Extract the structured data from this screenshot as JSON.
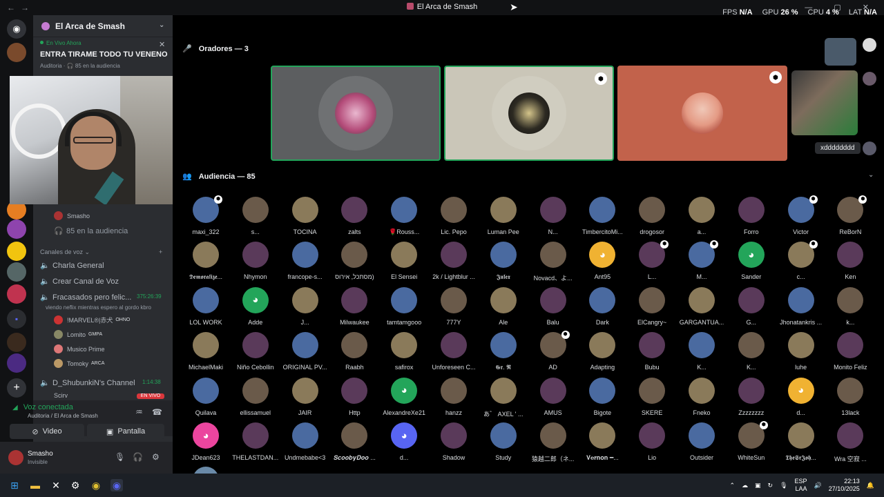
{
  "window": {
    "title": "El Arca de Smash",
    "controls": "— ▢ ✕"
  },
  "perf": {
    "fps_label": "FPS",
    "fps": "N/A",
    "gpu_label": "GPU",
    "gpu": "26 %",
    "cpu_label": "CPU",
    "cpu": "4 %",
    "lat_label": "LAT",
    "lat": "N/A"
  },
  "server": {
    "name": "El Arca de Smash"
  },
  "live": {
    "tag": "En Vivo Ahora",
    "title": "ENTRA TIRAME TODO TU VENENO",
    "meta": "Auditoria · 🎧 85 en la audiencia"
  },
  "sidebar": {
    "speaker_name": "Smasho",
    "audience_count": "85 en la audiencia",
    "voice_header": "Canales de voz",
    "channels": [
      {
        "name": "Charla General"
      },
      {
        "name": "Crear Canal de Voz"
      },
      {
        "name": "Fracasados pero felic...",
        "time": "375:26:39",
        "activity": "viendo neflix mientras espero al gordo kbro"
      },
      {
        "name": "D_ShubunkiN's Channel",
        "time": "1:14:38"
      }
    ],
    "channel_users": [
      {
        "name": "!MARVEL®|赤犬",
        "tag": "OHNO"
      },
      {
        "name": "Lomito",
        "tag": "GMPA"
      },
      {
        "name": "Musico Prime",
        "tag": ""
      },
      {
        "name": "Tomoky",
        "tag": "ARCA"
      }
    ],
    "partial_user": "Scirv",
    "en_vivo": "EN VIVO"
  },
  "voice": {
    "status": "Voz conectada",
    "dest": "Auditoria / El Arca de Smash",
    "video": "Video",
    "screen": "Pantalla"
  },
  "user": {
    "name": "Smasho",
    "status": "Invisible"
  },
  "stage": {
    "speakers_label": "Oradores — 3",
    "audience_label": "Audiencia — 85",
    "side_label": "xdddddddd"
  },
  "audience": [
    "maxi_322",
    "s...",
    "TOCINA",
    "zalts",
    "🌹Rouss...",
    "Lic. Pepo",
    "Luman Pee",
    "N...",
    "TimbercitoMi...",
    "drogosor",
    "a...",
    "Forro",
    "Victor",
    "ReBorN",
    "𝕯𝖊𝖒𝖔𝖗𝖆𝖑𝖎𝖟𝖊...",
    "Nhymon",
    "francope-s...",
    "מסתכל, אירוס)",
    "El Sensei",
    "2k / Lightblur ...",
    "𝕵𝖚𝖑𝖊𝖝",
    "Novacd、よ...",
    "Ant95",
    "L...",
    "M...",
    "Sander",
    "c...",
    "Ken",
    "LOL WORK",
    "Adde",
    "J...",
    "Milwaukee",
    "tamtamgooo",
    "777Y",
    "Ale",
    "Balu",
    "Dark",
    "ElCangry~",
    "GARGANTUA...",
    "G...",
    "Jhonatankris ...",
    "k...",
    "MichaelMaki",
    "Niño Cebollin",
    "ORIGINAL PV...",
    "Raabh",
    "safirox",
    "Unforeseen C...",
    "𝕲𝖗. 𝕽",
    "AD",
    "Adapting",
    "Bubu",
    "K...",
    "K...",
    "luhe",
    "Monito Feliz",
    "Quilava",
    "ellissamuel",
    "JAIR",
    "Http",
    "AlexandreXe21",
    "hanzz",
    "あ゛ AXEL ' ...",
    "AMUS",
    "Bigote",
    "SKERE",
    "Fneko",
    "Zzzzzzzz",
    "d...",
    "13lack",
    "JDean623",
    "THELASTDAN...",
    "Undmebabe<3",
    "𝑺𝒄𝒐𝒐𝒃𝒚𝑫𝒐𝒐 ...",
    "d...",
    "Shadow",
    "Study",
    "猿越二郎（ネ...",
    "𝐕𝐞𝐫𝐧𝐨𝐧 ━...",
    "Lio",
    "Outsider",
    "WhiteSun",
    "𝕿𝖍𝖊𝕾𝖗𝕵𝖔𝖍...",
    "Wra 空寂 ..."
  ],
  "taskbar": {
    "lang": "ESP",
    "layout": "LAA",
    "time": "22:13",
    "date": "27/10/2025"
  },
  "colors": {
    "accent": "#23a55a",
    "blurple": "#5865f2",
    "live": "#da373c"
  }
}
